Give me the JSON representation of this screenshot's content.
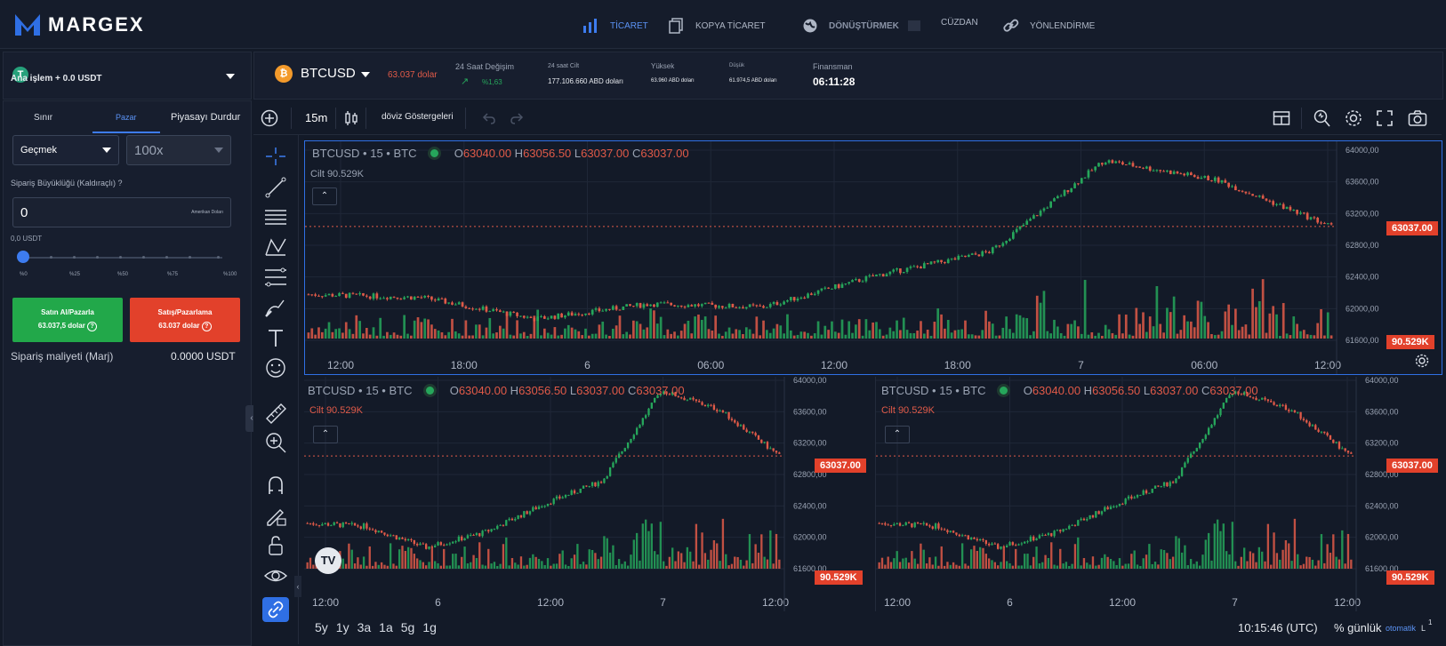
{
  "header": {
    "brand": "MARGEX",
    "nav": [
      {
        "label": "TİCARET",
        "icon": "bar-chart-icon"
      },
      {
        "label": "KOPYA TİCARET",
        "icon": "copy-icon"
      },
      {
        "label": "DÖNÜŞTÜRMEK",
        "icon": "globe-icon"
      },
      {
        "label": "CÜZDAN",
        "icon": "wallet-icon"
      },
      {
        "label": "YÖNLENDİRME",
        "icon": "link-icon"
      }
    ]
  },
  "account": {
    "label": "Ana işlem + 0.0 USDT"
  },
  "order": {
    "tabs": [
      "Sınır",
      "Pazar",
      "Piyasayı Durdur"
    ],
    "mode": "Geçmek",
    "leverage": "100x",
    "size_label": "Sipariş Büyüklüğü (Kaldıraçlı) ?",
    "size_value": "0",
    "size_unit": "Amerikan Doları",
    "size_usdt": "0,0 USDT",
    "slider_marks": [
      "%0",
      "%25",
      "%50",
      "%75",
      "%100"
    ],
    "slider_value": 0,
    "buy_label": "Satın Al/Pazarla",
    "buy_price": "63.037,5 dolar",
    "sell_label": "Satış/Pazarlama",
    "sell_price": "63.037 dolar",
    "cost_label": "Sipariş maliyeti (Marj)",
    "cost_value": "0.0000 USDT"
  },
  "ticker": {
    "symbol": "BTCUSD",
    "price": "63.037 dolar",
    "change_label": "24 Saat Değişim",
    "change_value": "%1,63",
    "volume_label": "24 saat Cilt",
    "volume_value": "177.106.660 ABD doları",
    "high_label": "Yüksek",
    "high_value": "63.960 ABD doları",
    "low_label": "Düşük",
    "low_value": "61.974,5 ABD doları",
    "funding_label": "Finansman",
    "funding_value": "06:11:28"
  },
  "toolbar": {
    "interval": "15m",
    "indicators": "döviz Göstergeleri"
  },
  "chart": {
    "title": "BTCUSD • 15 • BTC",
    "o": "63040.00",
    "h": "63056.50",
    "l": "63037.00",
    "c": "63037.00",
    "volume": "Cilt 90.529K",
    "last_price": "63037.00",
    "last_volume": "90.529K",
    "accent_up": "#26a65b",
    "accent_down": "#e05a48"
  },
  "chart_data": [
    {
      "type": "line",
      "title": "BTCUSD • 15 • BTC",
      "x": [
        "12:00",
        "18:00",
        "6",
        "06:00",
        "12:00",
        "18:00",
        "7",
        "06:00",
        "12:00"
      ],
      "series": [
        {
          "name": "BTCUSD",
          "values": [
            62180,
            62140,
            61870,
            62060,
            62020,
            62420,
            62720,
            63870,
            63620,
            63037
          ]
        }
      ],
      "ylim": [
        61600,
        64000
      ],
      "y_ticks": [
        "64000,00",
        "63600,00",
        "63200,00",
        "62800,00",
        "62400,00",
        "62000,00",
        "61600,00"
      ],
      "last_value": 63037,
      "volume_last": "90.529K"
    },
    {
      "type": "line",
      "title": "BTCUSD • 15 • BTC",
      "x": [
        "12:00",
        "6",
        "12:00",
        "7",
        "12:00"
      ],
      "series": [
        {
          "name": "BTCUSD",
          "values": [
            62180,
            62140,
            61870,
            62060,
            62420,
            62720,
            63870,
            63620,
            63037
          ]
        }
      ],
      "ylim": [
        61600,
        64000
      ],
      "y_ticks": [
        "64000,00",
        "63600,00",
        "63200,00",
        "62800,00",
        "62400,00",
        "62000,00",
        "61600,00"
      ],
      "last_value": 63037,
      "volume_last": "90.529K"
    },
    {
      "type": "line",
      "title": "BTCUSD • 15 • BTC",
      "x": [
        "12:00",
        "6",
        "12:00",
        "7",
        "12:00"
      ],
      "series": [
        {
          "name": "BTCUSD",
          "values": [
            62180,
            62140,
            61870,
            62060,
            62420,
            62720,
            63870,
            63620,
            63037
          ]
        }
      ],
      "ylim": [
        61600,
        64000
      ],
      "y_ticks": [
        "64000,00",
        "63600,00",
        "63200,00",
        "62800,00",
        "62400,00",
        "62000,00",
        "61600,00"
      ],
      "last_value": 63037,
      "volume_last": "90.529K"
    }
  ],
  "bottom": {
    "ranges": [
      "5y",
      "1y",
      "3a",
      "1a",
      "5g",
      "1g"
    ],
    "clock": "10:15:46 (UTC)",
    "pct": "% günlük",
    "auto": "otomatik",
    "log": "L"
  }
}
